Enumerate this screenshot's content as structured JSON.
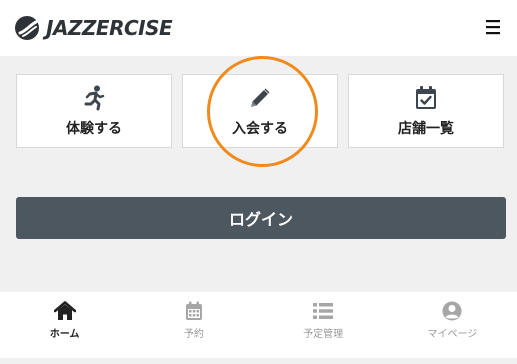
{
  "header": {
    "brand": "JAZZERCISE",
    "menu_icon": "hamburger-icon"
  },
  "actions": [
    {
      "label": "体験する",
      "icon": "running-icon"
    },
    {
      "label": "入会する",
      "icon": "pencil-icon"
    },
    {
      "label": "店舗一覧",
      "icon": "calendar-check-icon"
    }
  ],
  "login": {
    "label": "ログイン"
  },
  "bottom_nav": [
    {
      "label": "ホーム",
      "icon": "home-icon",
      "active": true
    },
    {
      "label": "予約",
      "icon": "calendar-icon",
      "active": false
    },
    {
      "label": "予定管理",
      "icon": "list-icon",
      "active": false
    },
    {
      "label": "マイページ",
      "icon": "user-circle-icon",
      "active": false
    }
  ],
  "colors": {
    "highlight": "#f08a1c",
    "login_bg": "#4d5760",
    "icon_dark": "#3d464e",
    "icon_inactive": "#a6a6a6"
  }
}
